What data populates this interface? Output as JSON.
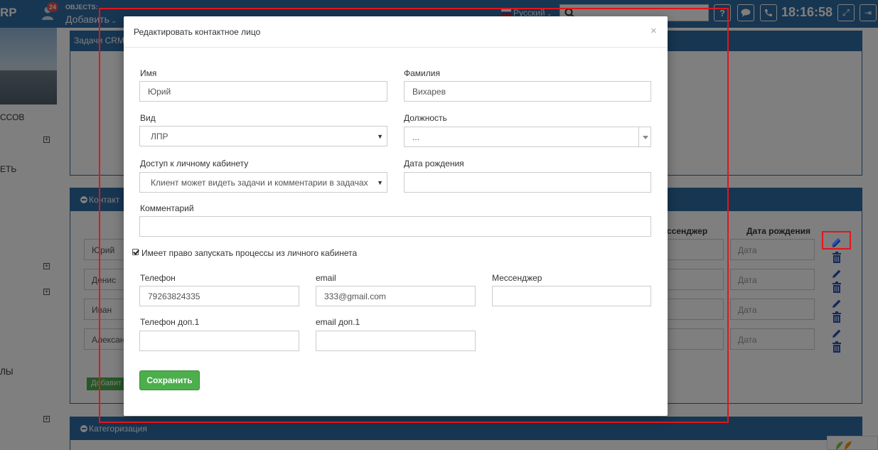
{
  "app": {
    "logo_fragment": "RP",
    "notification_count": "24",
    "objects_label": "OBJECTS:",
    "add_label": "Добавить",
    "language": "Русский",
    "clock": "18:16:58"
  },
  "sidebar": {
    "items": [
      "ССОВ",
      "ЕТЬ",
      "ЛЫ"
    ]
  },
  "background": {
    "tab_label": "Задачи CRM",
    "contacts_panel_title": "Контакт",
    "category_panel_title": "Категоризация",
    "table_headers": {
      "messenger": "ссенджер",
      "birthdate": "Дата рождения"
    },
    "rows": [
      {
        "name": "Юрий",
        "date_placeholder": "Дата"
      },
      {
        "name": "Денис",
        "date_placeholder": "Дата"
      },
      {
        "name": "Иван",
        "date_placeholder": "Дата"
      },
      {
        "name": "Алексан",
        "date_placeholder": "Дата"
      }
    ],
    "add_button": "Добавит"
  },
  "modal": {
    "title": "Редактировать контактное лицо",
    "close": "×",
    "fields": {
      "first_name": {
        "label": "Имя",
        "value": "Юрий"
      },
      "last_name": {
        "label": "Фамилия",
        "value": "Вихарев"
      },
      "kind": {
        "label": "Вид",
        "value": "ЛПР"
      },
      "position": {
        "label": "Должность",
        "value": "..."
      },
      "cabinet_access": {
        "label": "Доступ к личному кабинету",
        "value": "Клиент может видеть задачи и комментарии в задачах"
      },
      "birthdate": {
        "label": "Дата рождения",
        "value": ""
      },
      "comment": {
        "label": "Комментарий",
        "value": ""
      },
      "phone": {
        "label": "Телефон",
        "value": "79263824335"
      },
      "email": {
        "label": "email",
        "value": "333@gmail.com"
      },
      "messenger": {
        "label": "Мессенджер",
        "value": ""
      },
      "phone_extra": {
        "label": "Телефон доп.1",
        "value": ""
      },
      "email_extra": {
        "label": "email доп.1",
        "value": ""
      }
    },
    "can_start_processes": {
      "label": "Имеет право запускать процессы из личного кабинета",
      "checked": true
    },
    "save_button": "Сохранить"
  },
  "colors": {
    "primary": "#2e6da4",
    "success": "#4cae4c",
    "highlight": "#e0161b"
  }
}
